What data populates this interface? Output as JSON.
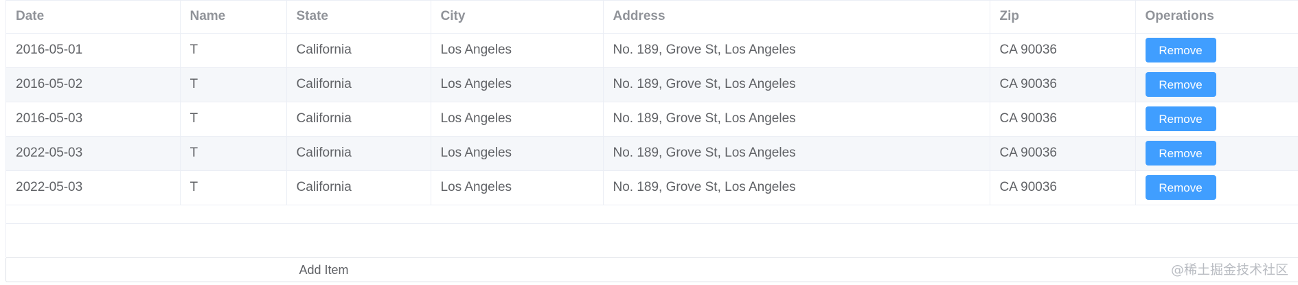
{
  "table": {
    "columns": [
      "Date",
      "Name",
      "State",
      "City",
      "Address",
      "Zip",
      "Operations"
    ],
    "rows": [
      {
        "date": "2016-05-01",
        "name": "T",
        "state": "California",
        "city": "Los Angeles",
        "address": "No. 189, Grove St, Los Angeles",
        "zip": "CA 90036",
        "action": "Remove"
      },
      {
        "date": "2016-05-02",
        "name": "T",
        "state": "California",
        "city": "Los Angeles",
        "address": "No. 189, Grove St, Los Angeles",
        "zip": "CA 90036",
        "action": "Remove"
      },
      {
        "date": "2016-05-03",
        "name": "T",
        "state": "California",
        "city": "Los Angeles",
        "address": "No. 189, Grove St, Los Angeles",
        "zip": "CA 90036",
        "action": "Remove"
      },
      {
        "date": "2022-05-03",
        "name": "T",
        "state": "California",
        "city": "Los Angeles",
        "address": "No. 189, Grove St, Los Angeles",
        "zip": "CA 90036",
        "action": "Remove"
      },
      {
        "date": "2022-05-03",
        "name": "T",
        "state": "California",
        "city": "Los Angeles",
        "address": "No. 189, Grove St, Los Angeles",
        "zip": "CA 90036",
        "action": "Remove"
      }
    ]
  },
  "footer": {
    "add_item_label": "Add Item"
  },
  "watermark": "@稀土掘金技术社区",
  "colors": {
    "primary": "#409eff",
    "header_text": "#909399",
    "body_text": "#606266",
    "stripe": "#f5f7fa",
    "border": "#ebeef5"
  }
}
